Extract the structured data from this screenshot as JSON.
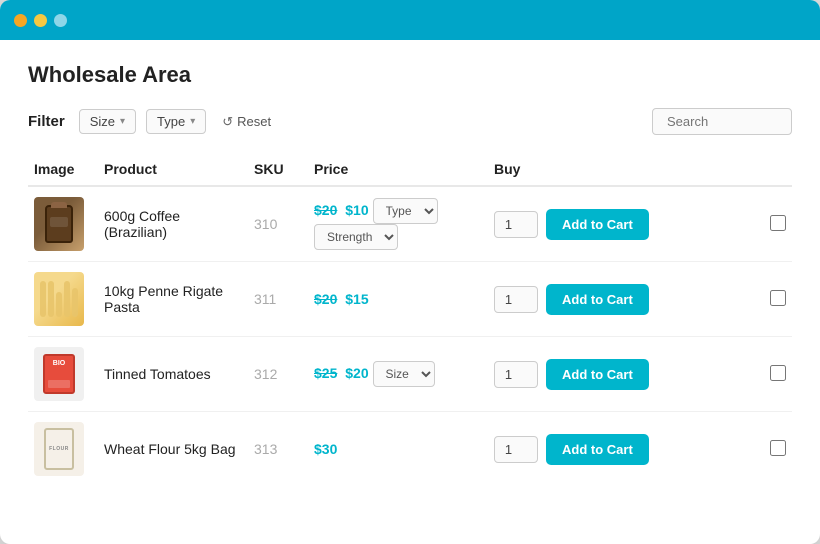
{
  "window": {
    "title": "Wholesale Area"
  },
  "titlebar": {
    "dots": [
      "red",
      "yellow",
      "green"
    ]
  },
  "page": {
    "title": "Wholesale Area"
  },
  "filter": {
    "label": "Filter",
    "size_label": "Size",
    "type_label": "Type",
    "reset_label": "Reset",
    "search_placeholder": "Search"
  },
  "table": {
    "headers": {
      "image": "Image",
      "product": "Product",
      "sku": "SKU",
      "price": "Price",
      "buy": "Buy"
    },
    "rows": [
      {
        "id": 1,
        "product": "600g Coffee (Brazilian)",
        "sku": "310",
        "price_original": "$20",
        "price_sale": "$10",
        "has_type_select": true,
        "has_strength_select": true,
        "type_label": "Type",
        "strength_label": "Strength",
        "qty": "1",
        "add_to_cart": "Add to Cart",
        "img_type": "coffee"
      },
      {
        "id": 2,
        "product": "10kg Penne Rigate Pasta",
        "sku": "311",
        "price_original": "$20",
        "price_sale": "$15",
        "has_type_select": false,
        "has_strength_select": false,
        "qty": "1",
        "add_to_cart": "Add to Cart",
        "img_type": "pasta"
      },
      {
        "id": 3,
        "product": "Tinned Tomatoes",
        "sku": "312",
        "price_original": "$25",
        "price_sale": "$20",
        "has_size_select": true,
        "size_label": "Size",
        "has_type_select": false,
        "has_strength_select": false,
        "qty": "1",
        "add_to_cart": "Add to Cart",
        "img_type": "tomato"
      },
      {
        "id": 4,
        "product": "Wheat Flour 5kg Bag",
        "sku": "313",
        "price_original": null,
        "price_sale": "$30",
        "has_type_select": false,
        "has_strength_select": false,
        "qty": "1",
        "add_to_cart": "Add to Cart",
        "img_type": "flour"
      }
    ]
  },
  "colors": {
    "accent": "#00b5cc",
    "titlebar": "#00a5c8"
  }
}
